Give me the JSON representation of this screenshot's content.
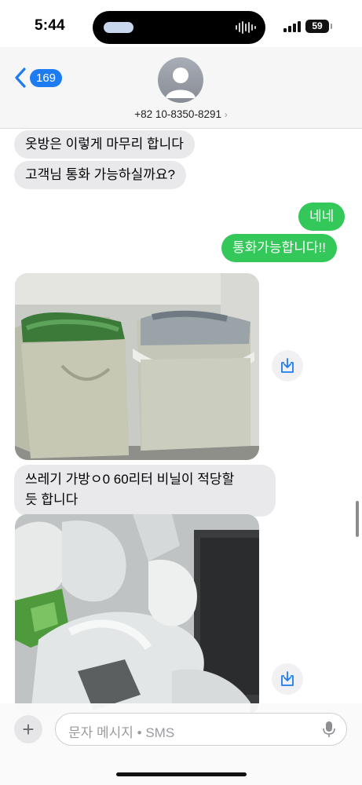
{
  "status": {
    "time": "5:44",
    "battery": "59"
  },
  "header": {
    "back_count": "169",
    "contact": "+82 10-8350-8291",
    "chevron": "›"
  },
  "messages": [
    {
      "dir": "in",
      "text": "옷방은 이렇게 마무리 합니다"
    },
    {
      "dir": "in",
      "text": "고객님 통화 가능하실까요?"
    },
    {
      "dir": "out",
      "text": "네네"
    },
    {
      "dir": "out",
      "text": "통화가능합니다!!"
    },
    {
      "dir": "in",
      "type": "photo",
      "alt_icon": "download-icon"
    },
    {
      "dir": "in",
      "text_line1": "쓰레기 가방ㅇ0 60리터 비닐이 적당할",
      "text_line2": "듯 합니다"
    },
    {
      "dir": "in",
      "type": "photo",
      "alt_icon": "download-icon"
    }
  ],
  "composer": {
    "placeholder": "문자 메시지 • SMS",
    "plus": "+"
  },
  "colors": {
    "outgoing": "#34c759",
    "incoming": "#e9e9eb",
    "accent": "#1d7cf2"
  }
}
